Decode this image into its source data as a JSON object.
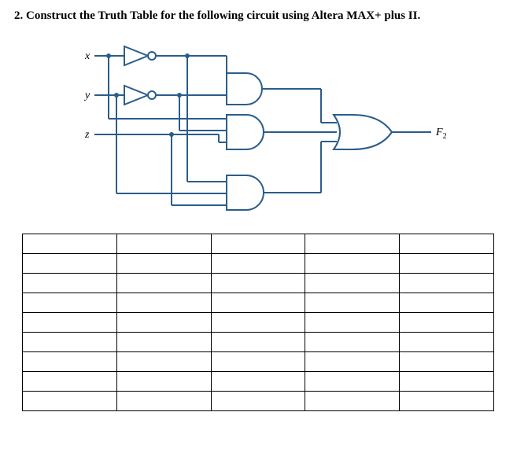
{
  "question": {
    "number": "2.",
    "text": "Construct the Truth Table for the following circuit using Altera MAX+ plus II."
  },
  "inputs": {
    "x": "x",
    "y": "y",
    "z": "z"
  },
  "output": {
    "f2": "F",
    "f2_sub": "2"
  },
  "truth_table": {
    "rows": 9,
    "cols": 5,
    "cells": [
      [
        "",
        "",
        "",
        "",
        ""
      ],
      [
        "",
        "",
        "",
        "",
        ""
      ],
      [
        "",
        "",
        "",
        "",
        ""
      ],
      [
        "",
        "",
        "",
        "",
        ""
      ],
      [
        "",
        "",
        "",
        "",
        ""
      ],
      [
        "",
        "",
        "",
        "",
        ""
      ],
      [
        "",
        "",
        "",
        "",
        ""
      ],
      [
        "",
        "",
        "",
        "",
        ""
      ],
      [
        "",
        "",
        "",
        "",
        ""
      ]
    ]
  }
}
